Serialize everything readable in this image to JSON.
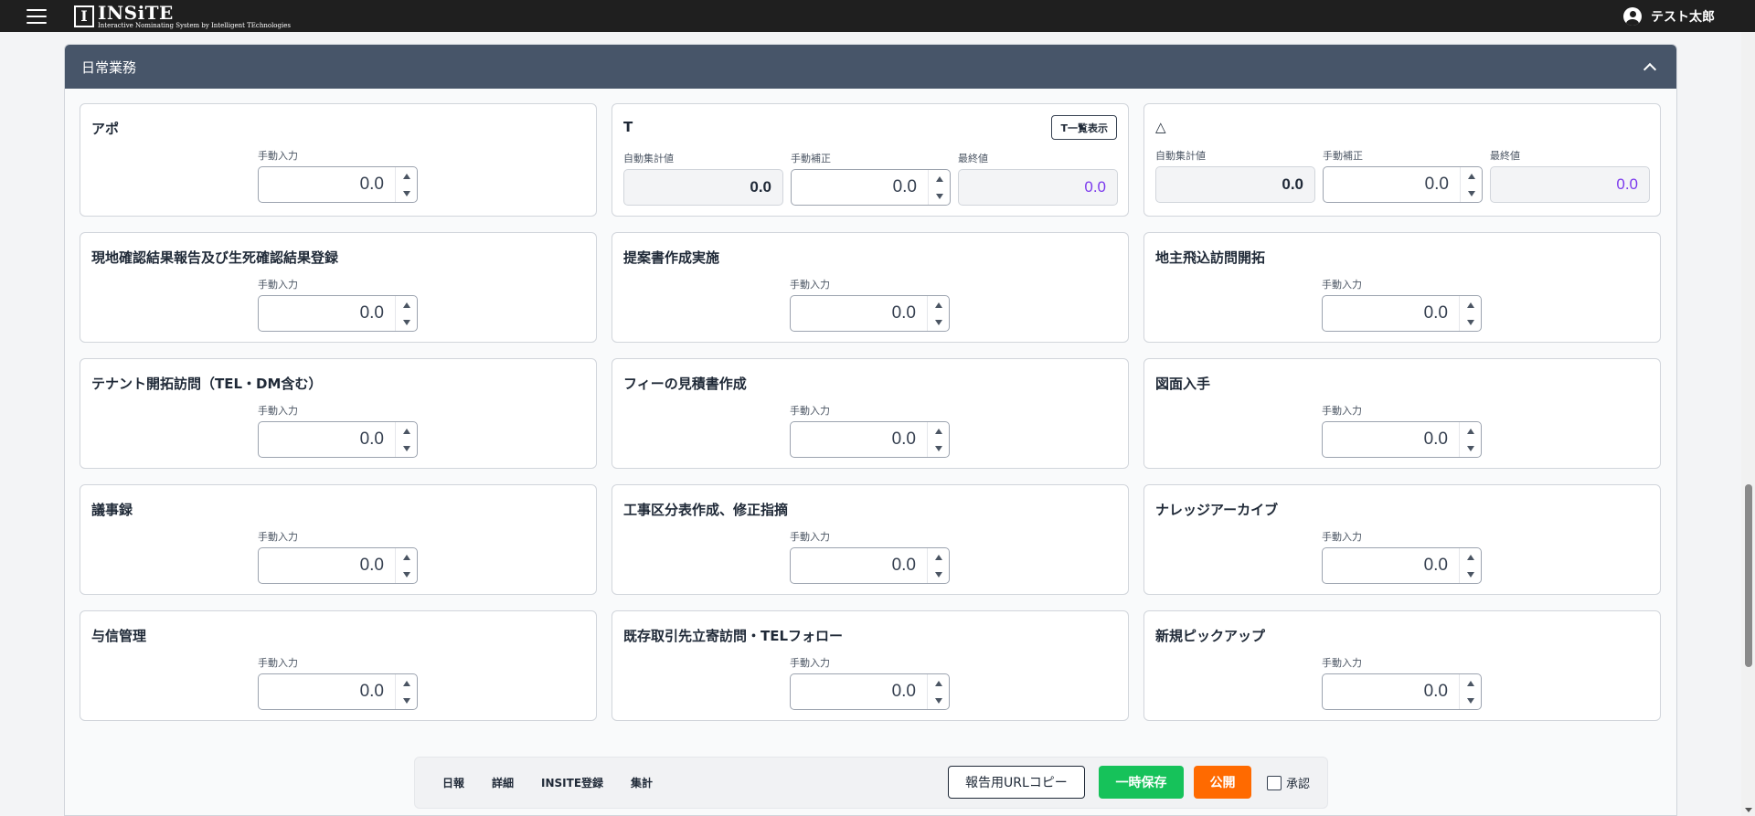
{
  "header": {
    "logo_mark": "I",
    "logo_name": "INSiTE",
    "logo_tagline": "Interactive Nominating System by Intelligent TEchnologies",
    "user_name": "テスト太郎"
  },
  "section": {
    "title": "日常業務"
  },
  "cards": [
    {
      "title": "アポ",
      "type": "manual",
      "label": "手動入力",
      "value": "0.0"
    },
    {
      "title": "T",
      "type": "triple",
      "button": "T一覧表示",
      "auto_label": "自動集計値",
      "auto_value": "0.0",
      "manual_label": "手動補正",
      "manual_value": "0.0",
      "final_label": "最終値",
      "final_value": "0.0"
    },
    {
      "title": "△",
      "type": "triple",
      "auto_label": "自動集計値",
      "auto_value": "0.0",
      "manual_label": "手動補正",
      "manual_value": "0.0",
      "final_label": "最終値",
      "final_value": "0.0"
    },
    {
      "title": "現地確認結果報告及び生死確認結果登録",
      "type": "manual",
      "label": "手動入力",
      "value": "0.0"
    },
    {
      "title": "提案書作成実施",
      "type": "manual",
      "label": "手動入力",
      "value": "0.0"
    },
    {
      "title": "地主飛込訪問開拓",
      "type": "manual",
      "label": "手動入力",
      "value": "0.0"
    },
    {
      "title": "テナント開拓訪問（TEL・DM含む）",
      "type": "manual",
      "label": "手動入力",
      "value": "0.0"
    },
    {
      "title": "フィーの見積書作成",
      "type": "manual",
      "label": "手動入力",
      "value": "0.0"
    },
    {
      "title": "図面入手",
      "type": "manual",
      "label": "手動入力",
      "value": "0.0"
    },
    {
      "title": "議事録",
      "type": "manual",
      "label": "手動入力",
      "value": "0.0"
    },
    {
      "title": "工事区分表作成、修正指摘",
      "type": "manual",
      "label": "手動入力",
      "value": "0.0"
    },
    {
      "title": "ナレッジアーカイブ",
      "type": "manual",
      "label": "手動入力",
      "value": "0.0"
    },
    {
      "title": "与信管理",
      "type": "manual",
      "label": "手動入力",
      "value": "0.0"
    },
    {
      "title": "既存取引先立寄訪問・TELフォロー",
      "type": "manual",
      "label": "手動入力",
      "value": "0.0"
    },
    {
      "title": "新規ピックアップ",
      "type": "manual",
      "label": "手動入力",
      "value": "0.0"
    }
  ],
  "bottombar": {
    "links": [
      "日報",
      "詳細",
      "INSITE登録",
      "集計"
    ],
    "url_copy": "報告用URLコピー",
    "temp_save": "一時保存",
    "publish": "公開",
    "approve": "承認"
  },
  "colors": {
    "save": "#16c25a",
    "publish": "#ff6a00",
    "final_value": "#7c3aed",
    "header": "#475569"
  }
}
